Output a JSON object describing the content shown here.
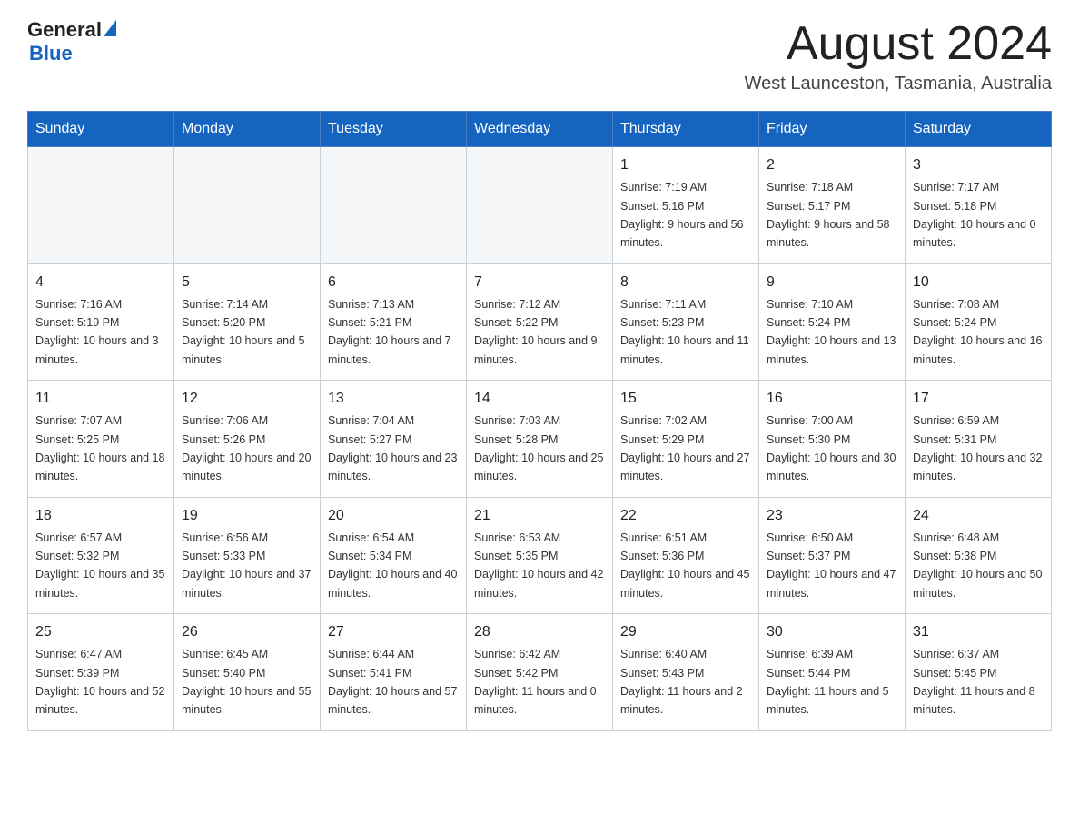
{
  "header": {
    "logo": {
      "general": "General",
      "blue": "Blue"
    },
    "title": "August 2024",
    "location": "West Launceston, Tasmania, Australia"
  },
  "calendar": {
    "days": [
      "Sunday",
      "Monday",
      "Tuesday",
      "Wednesday",
      "Thursday",
      "Friday",
      "Saturday"
    ],
    "weeks": [
      [
        {
          "day": "",
          "info": ""
        },
        {
          "day": "",
          "info": ""
        },
        {
          "day": "",
          "info": ""
        },
        {
          "day": "",
          "info": ""
        },
        {
          "day": "1",
          "info": "Sunrise: 7:19 AM\nSunset: 5:16 PM\nDaylight: 9 hours and 56 minutes."
        },
        {
          "day": "2",
          "info": "Sunrise: 7:18 AM\nSunset: 5:17 PM\nDaylight: 9 hours and 58 minutes."
        },
        {
          "day": "3",
          "info": "Sunrise: 7:17 AM\nSunset: 5:18 PM\nDaylight: 10 hours and 0 minutes."
        }
      ],
      [
        {
          "day": "4",
          "info": "Sunrise: 7:16 AM\nSunset: 5:19 PM\nDaylight: 10 hours and 3 minutes."
        },
        {
          "day": "5",
          "info": "Sunrise: 7:14 AM\nSunset: 5:20 PM\nDaylight: 10 hours and 5 minutes."
        },
        {
          "day": "6",
          "info": "Sunrise: 7:13 AM\nSunset: 5:21 PM\nDaylight: 10 hours and 7 minutes."
        },
        {
          "day": "7",
          "info": "Sunrise: 7:12 AM\nSunset: 5:22 PM\nDaylight: 10 hours and 9 minutes."
        },
        {
          "day": "8",
          "info": "Sunrise: 7:11 AM\nSunset: 5:23 PM\nDaylight: 10 hours and 11 minutes."
        },
        {
          "day": "9",
          "info": "Sunrise: 7:10 AM\nSunset: 5:24 PM\nDaylight: 10 hours and 13 minutes."
        },
        {
          "day": "10",
          "info": "Sunrise: 7:08 AM\nSunset: 5:24 PM\nDaylight: 10 hours and 16 minutes."
        }
      ],
      [
        {
          "day": "11",
          "info": "Sunrise: 7:07 AM\nSunset: 5:25 PM\nDaylight: 10 hours and 18 minutes."
        },
        {
          "day": "12",
          "info": "Sunrise: 7:06 AM\nSunset: 5:26 PM\nDaylight: 10 hours and 20 minutes."
        },
        {
          "day": "13",
          "info": "Sunrise: 7:04 AM\nSunset: 5:27 PM\nDaylight: 10 hours and 23 minutes."
        },
        {
          "day": "14",
          "info": "Sunrise: 7:03 AM\nSunset: 5:28 PM\nDaylight: 10 hours and 25 minutes."
        },
        {
          "day": "15",
          "info": "Sunrise: 7:02 AM\nSunset: 5:29 PM\nDaylight: 10 hours and 27 minutes."
        },
        {
          "day": "16",
          "info": "Sunrise: 7:00 AM\nSunset: 5:30 PM\nDaylight: 10 hours and 30 minutes."
        },
        {
          "day": "17",
          "info": "Sunrise: 6:59 AM\nSunset: 5:31 PM\nDaylight: 10 hours and 32 minutes."
        }
      ],
      [
        {
          "day": "18",
          "info": "Sunrise: 6:57 AM\nSunset: 5:32 PM\nDaylight: 10 hours and 35 minutes."
        },
        {
          "day": "19",
          "info": "Sunrise: 6:56 AM\nSunset: 5:33 PM\nDaylight: 10 hours and 37 minutes."
        },
        {
          "day": "20",
          "info": "Sunrise: 6:54 AM\nSunset: 5:34 PM\nDaylight: 10 hours and 40 minutes."
        },
        {
          "day": "21",
          "info": "Sunrise: 6:53 AM\nSunset: 5:35 PM\nDaylight: 10 hours and 42 minutes."
        },
        {
          "day": "22",
          "info": "Sunrise: 6:51 AM\nSunset: 5:36 PM\nDaylight: 10 hours and 45 minutes."
        },
        {
          "day": "23",
          "info": "Sunrise: 6:50 AM\nSunset: 5:37 PM\nDaylight: 10 hours and 47 minutes."
        },
        {
          "day": "24",
          "info": "Sunrise: 6:48 AM\nSunset: 5:38 PM\nDaylight: 10 hours and 50 minutes."
        }
      ],
      [
        {
          "day": "25",
          "info": "Sunrise: 6:47 AM\nSunset: 5:39 PM\nDaylight: 10 hours and 52 minutes."
        },
        {
          "day": "26",
          "info": "Sunrise: 6:45 AM\nSunset: 5:40 PM\nDaylight: 10 hours and 55 minutes."
        },
        {
          "day": "27",
          "info": "Sunrise: 6:44 AM\nSunset: 5:41 PM\nDaylight: 10 hours and 57 minutes."
        },
        {
          "day": "28",
          "info": "Sunrise: 6:42 AM\nSunset: 5:42 PM\nDaylight: 11 hours and 0 minutes."
        },
        {
          "day": "29",
          "info": "Sunrise: 6:40 AM\nSunset: 5:43 PM\nDaylight: 11 hours and 2 minutes."
        },
        {
          "day": "30",
          "info": "Sunrise: 6:39 AM\nSunset: 5:44 PM\nDaylight: 11 hours and 5 minutes."
        },
        {
          "day": "31",
          "info": "Sunrise: 6:37 AM\nSunset: 5:45 PM\nDaylight: 11 hours and 8 minutes."
        }
      ]
    ]
  }
}
